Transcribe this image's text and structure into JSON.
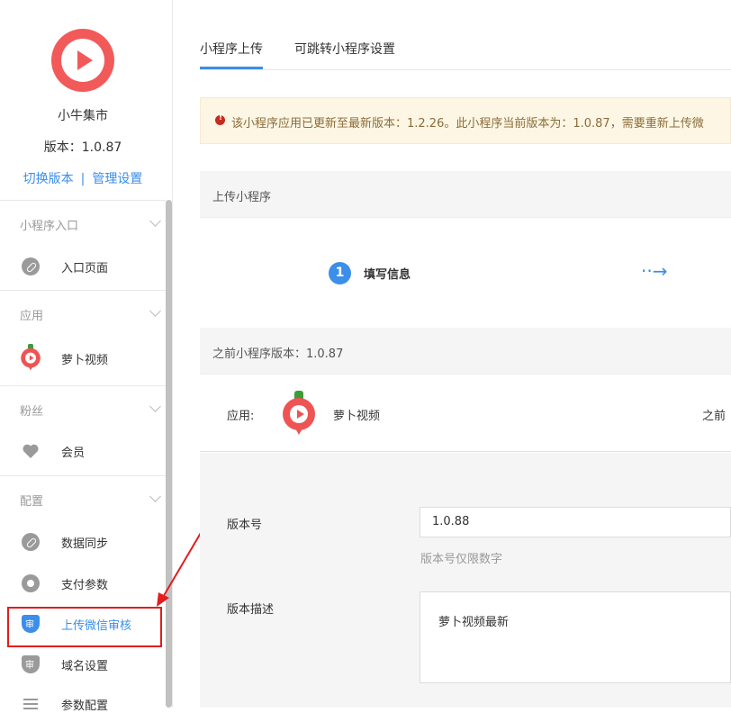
{
  "sidebar": {
    "app_name": "小牛集市",
    "version": "版本：1.0.87",
    "switch_version": "切换版本",
    "separator": "|",
    "manage_settings": "管理设置",
    "sections": [
      {
        "title": "小程序入口",
        "items": [
          {
            "label": "入口页面",
            "icon": "link-icon"
          }
        ]
      },
      {
        "title": "应用",
        "items": [
          {
            "label": "萝卜视频",
            "icon": "radish-video-icon"
          }
        ]
      },
      {
        "title": "粉丝",
        "items": [
          {
            "label": "会员",
            "icon": "heart-icon"
          }
        ]
      },
      {
        "title": "配置",
        "items": [
          {
            "label": "数据同步",
            "icon": "link-icon"
          },
          {
            "label": "支付参数",
            "icon": "gear-icon"
          },
          {
            "label": "上传微信审核",
            "icon": "shield-icon",
            "active": true
          },
          {
            "label": "域名设置",
            "icon": "shield-icon"
          },
          {
            "label": "参数配置",
            "icon": "list-icon"
          }
        ]
      }
    ]
  },
  "tabs": [
    {
      "label": "小程序上传",
      "active": true
    },
    {
      "label": "可跳转小程序设置",
      "active": false
    }
  ],
  "alert": {
    "text": "该小程序应用已更新至最新版本：1.2.26。此小程序当前版本为：1.0.87，需要重新上传微"
  },
  "upload_panel": {
    "title": "上传小程序",
    "step_number": "1",
    "step_label": "填写信息",
    "step_arrow": "··→"
  },
  "previous": {
    "title": "之前小程序版本：1.0.87",
    "app_label": "应用:",
    "app_name": "萝卜视频",
    "right_label": "之前"
  },
  "form": {
    "version_label": "版本号",
    "version_value": "1.0.88",
    "version_hint": "版本号仅限数字",
    "desc_label": "版本描述",
    "desc_value": "萝卜视频最新"
  },
  "colors": {
    "accent": "#3b8ee9",
    "annotation": "#e21d1d",
    "logo": "#f25a5a"
  }
}
